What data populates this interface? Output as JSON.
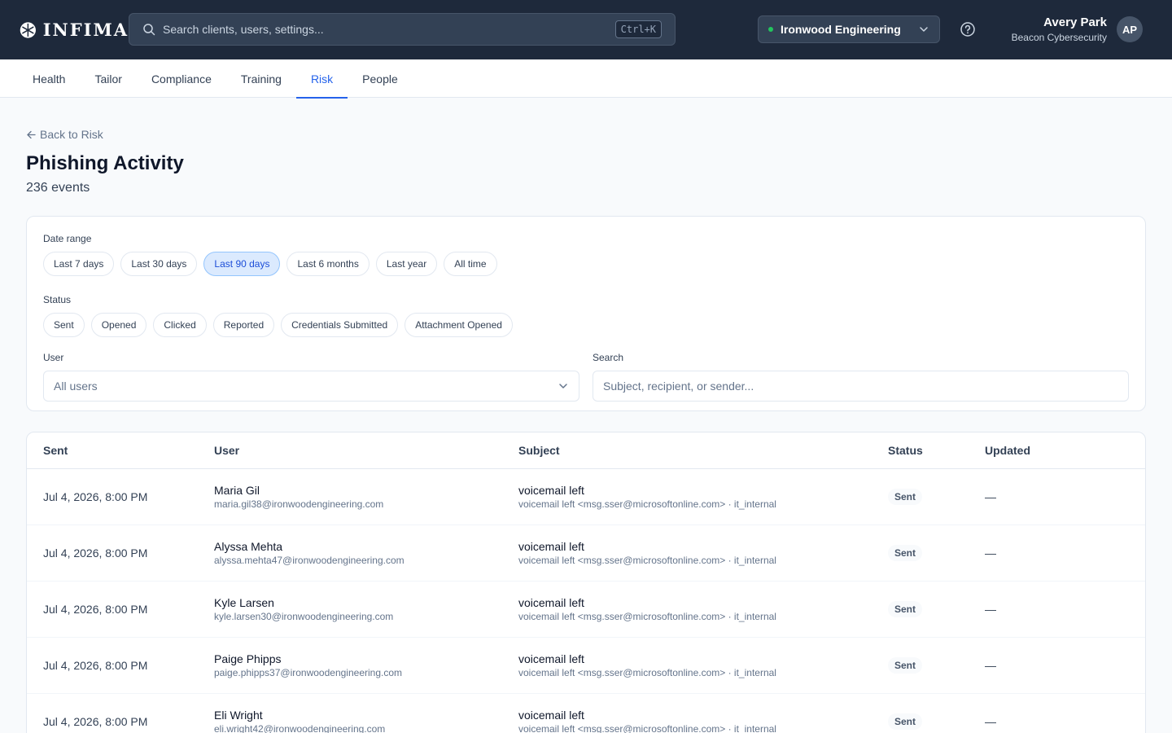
{
  "app": {
    "brand": "INFIMA"
  },
  "search": {
    "placeholder": "Search clients, users, settings...",
    "shortcut": "Ctrl+K"
  },
  "org_selector": {
    "value": "Ironwood Engineering",
    "status_color": "#22c55e"
  },
  "user": {
    "name": "Avery Park",
    "org": "Beacon Cybersecurity",
    "initials": "AP"
  },
  "tabs": [
    {
      "label": "Health"
    },
    {
      "label": "Tailor"
    },
    {
      "label": "Compliance"
    },
    {
      "label": "Training"
    },
    {
      "label": "Risk",
      "active": true
    },
    {
      "label": "People"
    }
  ],
  "page": {
    "back_label": "Back to Risk",
    "title": "Phishing Activity",
    "count": "236 events"
  },
  "filters": {
    "date_label": "Date range",
    "date_options": [
      "Last 7 days",
      "Last 30 days",
      "Last 90 days",
      "Last 6 months",
      "Last year",
      "All time"
    ],
    "date_selected": "Last 90 days",
    "status_label": "Status",
    "status_options": [
      "Sent",
      "Opened",
      "Clicked",
      "Reported",
      "Credentials Submitted",
      "Attachment Opened"
    ],
    "user_label": "User",
    "user_value": "All users",
    "search_label": "Search",
    "search_placeholder": "Subject, recipient, or sender..."
  },
  "table": {
    "headers": {
      "sent": "Sent",
      "user": "User",
      "subject": "Subject",
      "status": "Status",
      "updated": "Updated"
    },
    "rows": [
      {
        "sent": "Jul 4, 2026, 8:00 PM",
        "name": "Maria Gil",
        "email": "maria.gil38@ironwoodengineering.com",
        "subject": "voicemail left",
        "detail": "voicemail left <msg.sser@microsoftonline.com> · it_internal",
        "status": "Sent",
        "updated": "—"
      },
      {
        "sent": "Jul 4, 2026, 8:00 PM",
        "name": "Alyssa Mehta",
        "email": "alyssa.mehta47@ironwoodengineering.com",
        "subject": "voicemail left",
        "detail": "voicemail left <msg.sser@microsoftonline.com> · it_internal",
        "status": "Sent",
        "updated": "—"
      },
      {
        "sent": "Jul 4, 2026, 8:00 PM",
        "name": "Kyle Larsen",
        "email": "kyle.larsen30@ironwoodengineering.com",
        "subject": "voicemail left",
        "detail": "voicemail left <msg.sser@microsoftonline.com> · it_internal",
        "status": "Sent",
        "updated": "—"
      },
      {
        "sent": "Jul 4, 2026, 8:00 PM",
        "name": "Paige Phipps",
        "email": "paige.phipps37@ironwoodengineering.com",
        "subject": "voicemail left",
        "detail": "voicemail left <msg.sser@microsoftonline.com> · it_internal",
        "status": "Sent",
        "updated": "—"
      },
      {
        "sent": "Jul 4, 2026, 8:00 PM",
        "name": "Eli Wright",
        "email": "eli.wright42@ironwoodengineering.com",
        "subject": "voicemail left",
        "detail": "voicemail left <msg.sser@microsoftonline.com> · it_internal",
        "status": "Sent",
        "updated": "—"
      }
    ]
  }
}
